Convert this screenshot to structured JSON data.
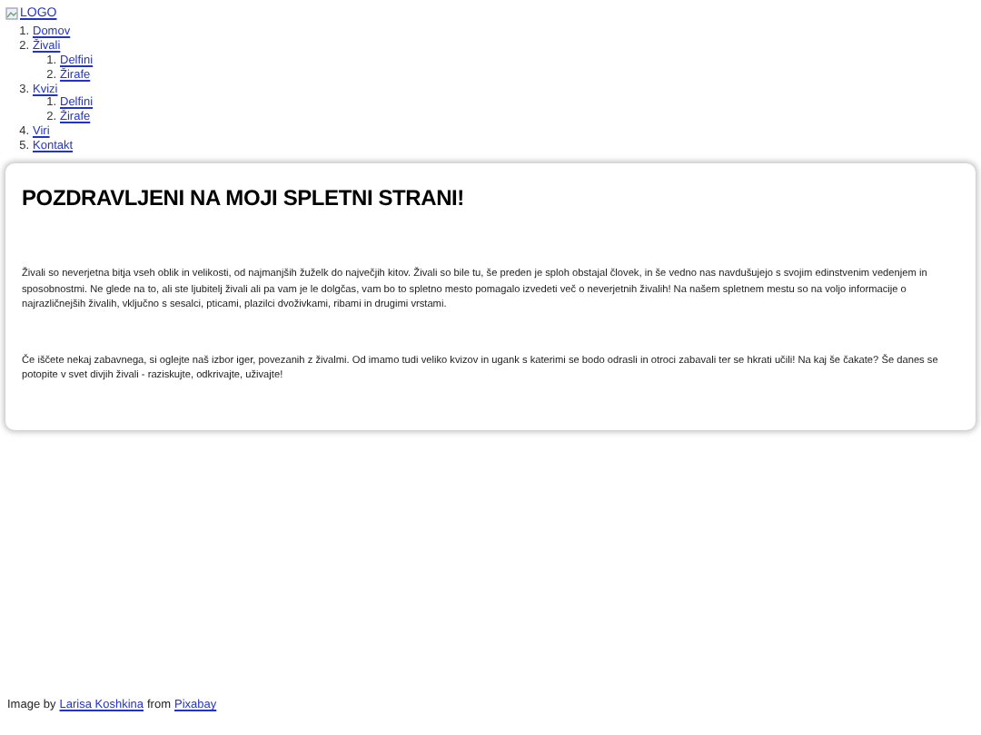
{
  "logo": {
    "alt": "LOGO"
  },
  "nav": [
    {
      "number": "1.",
      "label": "Domov"
    },
    {
      "number": "2.",
      "label": "Živali",
      "children": [
        {
          "number": "1.",
          "label": "Delfini"
        },
        {
          "number": "2.",
          "label": "Žirafe"
        }
      ]
    },
    {
      "number": "3.",
      "label": "Kvizi",
      "children": [
        {
          "number": "1.",
          "label": "Delfini"
        },
        {
          "number": "2.",
          "label": "Žirafe"
        }
      ]
    },
    {
      "number": "4.",
      "label": "Viri"
    },
    {
      "number": "5.",
      "label": "Kontakt"
    }
  ],
  "main": {
    "heading": "POZDRAVLJENI NA MOJI SPLETNI STRANI!",
    "paragraphs": [
      "Živali so neverjetna bitja vseh oblik in velikosti, od najmanjših žuželk do največjih kitov. Živali so bile tu, še preden je sploh obstajal človek, in še vedno nas navdušujejo s svojim edinstvenim vedenjem in sposobnostmi. Ne glede na to, ali ste ljubitelj živali ali pa vam je le dolgčas, vam bo to spletno mesto pomagalo izvedeti več o neverjetnih živalih! Na našem spletnem mestu so na voljo informacije o najrazličnejših živalih, vključno s sesalci, pticami, plazilci dvoživkami, ribami in drugimi vrstami.",
      "Če iščete nekaj zabavnega, si oglejte naš izbor iger, povezanih z živalmi. Od imamo tudi veliko kvizov in ugank s katerimi se bodo odrasli in otroci zabavali ter se hkrati učili! Na kaj še čakate? Še danes se potopite v svet divjih živali - raziskujte, odkrivajte, uživajte!"
    ]
  },
  "credit": {
    "prefix": "Image by",
    "author": "Larisa Koshkina",
    "middle": "from",
    "source": "Pixabay"
  }
}
